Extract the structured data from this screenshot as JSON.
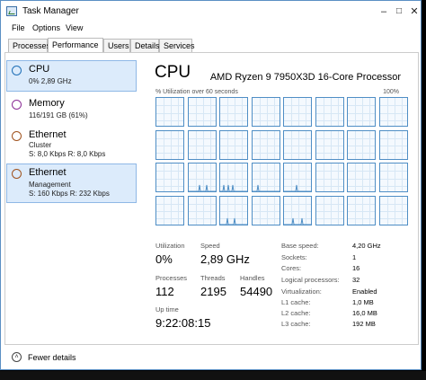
{
  "window": {
    "title": "Task Manager",
    "minimize": "–",
    "maximize": "□",
    "close": "✕"
  },
  "menu": [
    "File",
    "Options",
    "View"
  ],
  "tabs": [
    {
      "label": "Processes",
      "active": false
    },
    {
      "label": "Performance",
      "active": true
    },
    {
      "label": "Users",
      "active": false
    },
    {
      "label": "Details",
      "active": false
    },
    {
      "label": "Services",
      "active": false
    }
  ],
  "sidebar": [
    {
      "title": "CPU",
      "sub1": "0%  2,89 GHz",
      "sub2": "",
      "color": "#1f6fb7",
      "selected": true
    },
    {
      "title": "Memory",
      "sub1": "116/191 GB (61%)",
      "sub2": "",
      "color": "#8b2c96",
      "selected": false
    },
    {
      "title": "Ethernet",
      "sub1": "Cluster",
      "sub2": "S: 8,0 Kbps  R: 8,0 Kbps",
      "color": "#a0521d",
      "selected": false
    },
    {
      "title": "Ethernet",
      "sub1": "Management",
      "sub2": "S: 160 Kbps  R: 232 Kbps",
      "color": "#a0521d",
      "selected": true
    }
  ],
  "cpu": {
    "title": "CPU",
    "processor": "AMD Ryzen 9 7950X3D 16-Core Processor",
    "util_label": "% Utilization over 60 seconds",
    "util_max": "100%",
    "graph_color": "#4f8ec5",
    "graph_count": 32
  },
  "stats": {
    "utilization_label": "Utilization",
    "utilization": "0%",
    "speed_label": "Speed",
    "speed": "2,89 GHz",
    "processes_label": "Processes",
    "processes": "112",
    "threads_label": "Threads",
    "threads": "2195",
    "handles_label": "Handles",
    "handles": "54490",
    "uptime_label": "Up time",
    "uptime": "9:22:08:15"
  },
  "specs": [
    {
      "label": "Base speed:",
      "value": "4,20 GHz"
    },
    {
      "label": "Sockets:",
      "value": "1"
    },
    {
      "label": "Cores:",
      "value": "16"
    },
    {
      "label": "Logical processors:",
      "value": "32"
    },
    {
      "label": "Virtualization:",
      "value": "Enabled"
    },
    {
      "label": "L1 cache:",
      "value": "1,0 MB"
    },
    {
      "label": "L2 cache:",
      "value": "16,0 MB"
    },
    {
      "label": "L3 cache:",
      "value": "192 MB"
    }
  ],
  "footer": {
    "fewer_details": "Fewer details",
    "fewer_icon": "chevron-up-icon"
  }
}
